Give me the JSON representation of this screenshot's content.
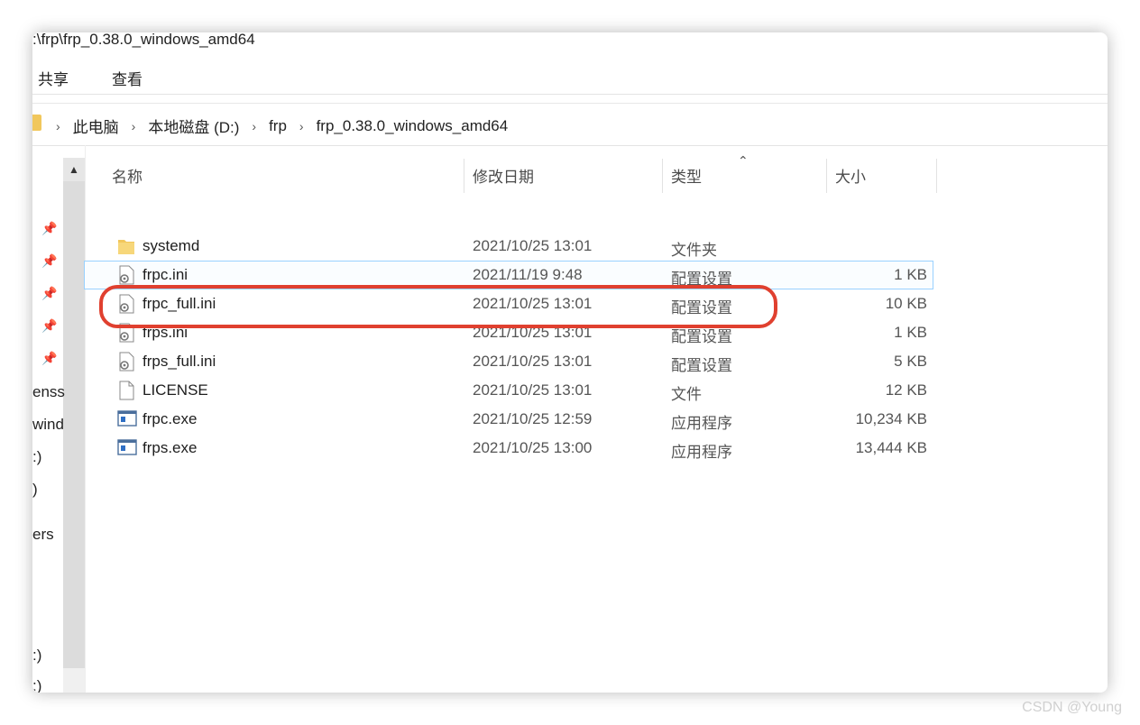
{
  "window": {
    "title": ":\\frp\\frp_0.38.0_windows_amd64"
  },
  "ribbon": {
    "tabs": [
      {
        "label": "共享"
      },
      {
        "label": "查看"
      }
    ]
  },
  "breadcrumb": [
    "此电脑",
    "本地磁盘 (D:)",
    "frp",
    "frp_0.38.0_windows_amd64"
  ],
  "nav": {
    "fragments": [
      "enss",
      "wind",
      ":)",
      ")",
      "ers",
      ":)",
      ":)"
    ]
  },
  "columns": {
    "name": "名称",
    "date": "修改日期",
    "type": "类型",
    "size": "大小"
  },
  "files": [
    {
      "name": "systemd",
      "date": "2021/10/25 13:01",
      "type": "文件夹",
      "size": "",
      "icon": "folder-icon"
    },
    {
      "name": "frpc.ini",
      "date": "2021/11/19 9:48",
      "type": "配置设置",
      "size": "1 KB",
      "icon": "config-file-icon",
      "selected": true
    },
    {
      "name": "frpc_full.ini",
      "date": "2021/10/25 13:01",
      "type": "配置设置",
      "size": "10 KB",
      "icon": "config-file-icon"
    },
    {
      "name": "frps.ini",
      "date": "2021/10/25 13:01",
      "type": "配置设置",
      "size": "1 KB",
      "icon": "config-file-icon",
      "highlighted": true
    },
    {
      "name": "frps_full.ini",
      "date": "2021/10/25 13:01",
      "type": "配置设置",
      "size": "5 KB",
      "icon": "config-file-icon"
    },
    {
      "name": "LICENSE",
      "date": "2021/10/25 13:01",
      "type": "文件",
      "size": "12 KB",
      "icon": "document-icon"
    },
    {
      "name": "frpc.exe",
      "date": "2021/10/25 12:59",
      "type": "应用程序",
      "size": "10,234 KB",
      "icon": "application-icon"
    },
    {
      "name": "frps.exe",
      "date": "2021/10/25 13:00",
      "type": "应用程序",
      "size": "13,444 KB",
      "icon": "application-icon"
    }
  ],
  "watermark": "CSDN @Young",
  "colors": {
    "highlight": "#e0402f",
    "selection": "#99d1ff",
    "folder": "#f1c75c"
  }
}
